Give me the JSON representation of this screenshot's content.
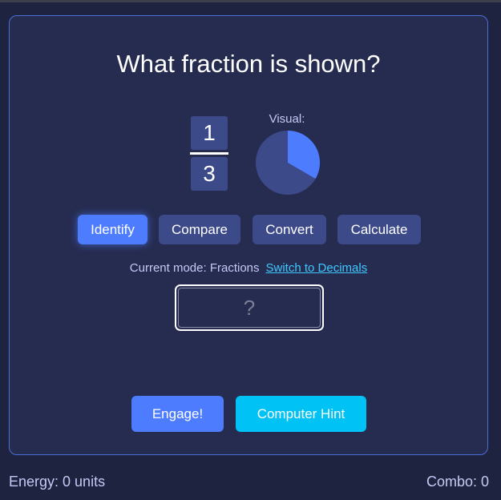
{
  "question": {
    "title": "What fraction is shown?",
    "numerator": "1",
    "denominator": "3",
    "visual_label": "Visual:",
    "pie_filled_fraction": 0.3333
  },
  "modes": [
    {
      "label": "Identify",
      "active": true
    },
    {
      "label": "Compare",
      "active": false
    },
    {
      "label": "Convert",
      "active": false
    },
    {
      "label": "Calculate",
      "active": false
    }
  ],
  "status": {
    "mode_text": "Current mode: Fractions",
    "switch_link": "Switch to Decimals"
  },
  "answer": {
    "placeholder": "?",
    "value": ""
  },
  "actions": {
    "engage_label": "Engage!",
    "hint_label": "Computer Hint"
  },
  "footer": {
    "energy_text": "Energy: 0 units",
    "combo_text": "Combo: 0"
  },
  "colors": {
    "background": "#1e2440",
    "card": "#262c50",
    "accent": "#4d7cff",
    "secondary_button": "#3c4a8a",
    "hint": "#00c2f5",
    "link": "#3ec8ff",
    "pie_filled": "#4d7cff",
    "pie_empty": "#3c4a8a"
  }
}
